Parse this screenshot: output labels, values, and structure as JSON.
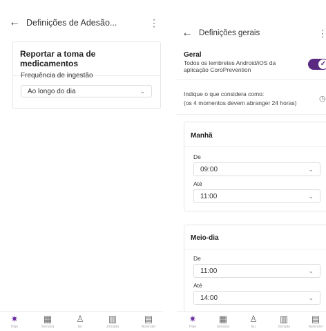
{
  "left": {
    "title": "Definições de Adesão...",
    "card_title": "Reportar a toma de medicamentos",
    "frequency_label": "Frequência de ingestão",
    "frequency_value": "Ao longo do dia"
  },
  "right": {
    "title": "Definições gerais",
    "general_heading": "Geral",
    "general_desc_1": "Todos os lembretes Android/iOS da",
    "general_desc_2": "aplicação CoroPrevention",
    "indicate_line1": "Indique o que considera como:",
    "indicate_line2": "(os 4 momentos devem abranger 24 horas)",
    "morning": {
      "title": "Manhã",
      "from_label": "De",
      "from_value": "09:00",
      "to_label": "Até",
      "to_value": "11:00"
    },
    "midday": {
      "title": "Meio-dia",
      "from_label": "De",
      "from_value": "11:00",
      "to_label": "Até",
      "to_value": "14:00"
    }
  },
  "nav": {
    "items": [
      {
        "icon": "sun-icon",
        "glyph": "✷",
        "label": "Hoje"
      },
      {
        "icon": "calendar-icon",
        "glyph": "▦",
        "label": "Semana"
      },
      {
        "icon": "person-icon",
        "glyph": "♙",
        "label": "Eu"
      },
      {
        "icon": "map-icon",
        "glyph": "▥",
        "label": "Jornada"
      },
      {
        "icon": "book-icon",
        "glyph": "▤",
        "label": "Aprender"
      }
    ]
  },
  "colors": {
    "accent": "#6b2fa0",
    "toggle": "#5a2a82"
  }
}
